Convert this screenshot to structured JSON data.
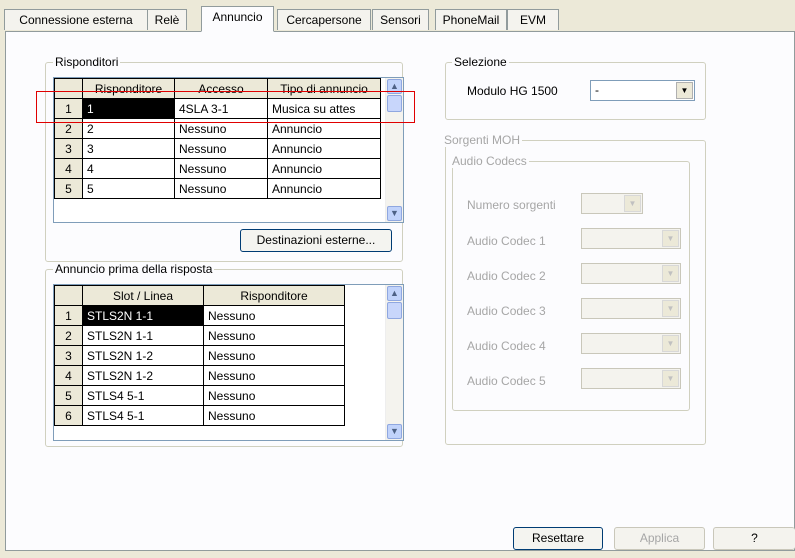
{
  "tabs": [
    "Connessione esterna",
    "Relè",
    "Annuncio",
    "Cercapersone",
    "Sensori",
    "PhoneMail",
    "EVM"
  ],
  "active_tab": "Annuncio",
  "risponditori": {
    "legend": "Risponditori",
    "columns": [
      "Risponditore",
      "Accesso",
      "Tipo di annuncio"
    ],
    "rows": [
      {
        "n": "1",
        "risponditore": "1",
        "accesso": "4SLA  3-1",
        "tipo": "Musica su attes"
      },
      {
        "n": "2",
        "risponditore": "2",
        "accesso": "Nessuno",
        "tipo": "Annuncio"
      },
      {
        "n": "3",
        "risponditore": "3",
        "accesso": "Nessuno",
        "tipo": "Annuncio"
      },
      {
        "n": "4",
        "risponditore": "4",
        "accesso": "Nessuno",
        "tipo": "Annuncio"
      },
      {
        "n": "5",
        "risponditore": "5",
        "accesso": "Nessuno",
        "tipo": "Annuncio"
      }
    ],
    "button": "Destinazioni esterne..."
  },
  "annuncio": {
    "legend": "Annuncio prima della risposta",
    "columns": [
      "Slot / Linea",
      "Risponditore"
    ],
    "rows": [
      {
        "n": "1",
        "slot": "STLS2N  1-1",
        "risp": "Nessuno"
      },
      {
        "n": "2",
        "slot": "STLS2N  1-1",
        "risp": "Nessuno"
      },
      {
        "n": "3",
        "slot": "STLS2N  1-2",
        "risp": "Nessuno"
      },
      {
        "n": "4",
        "slot": "STLS2N  1-2",
        "risp": "Nessuno"
      },
      {
        "n": "5",
        "slot": "STLS4  5-1",
        "risp": "Nessuno"
      },
      {
        "n": "6",
        "slot": "STLS4  5-1",
        "risp": "Nessuno"
      }
    ]
  },
  "selezione": {
    "legend": "Selezione",
    "modulo_label": "Modulo HG 1500",
    "modulo_value": "-"
  },
  "sorgenti": {
    "legend": "Sorgenti MOH",
    "codecs_legend": "Audio Codecs",
    "fields": [
      {
        "label": "Numero sorgenti",
        "value": ""
      },
      {
        "label": "Audio Codec 1",
        "value": ""
      },
      {
        "label": "Audio Codec 2",
        "value": ""
      },
      {
        "label": "Audio Codec 3",
        "value": ""
      },
      {
        "label": "Audio Codec 4",
        "value": ""
      },
      {
        "label": "Audio Codec 5",
        "value": ""
      }
    ]
  },
  "buttons": {
    "reset": "Resettare",
    "apply": "Applica",
    "help": "?"
  }
}
